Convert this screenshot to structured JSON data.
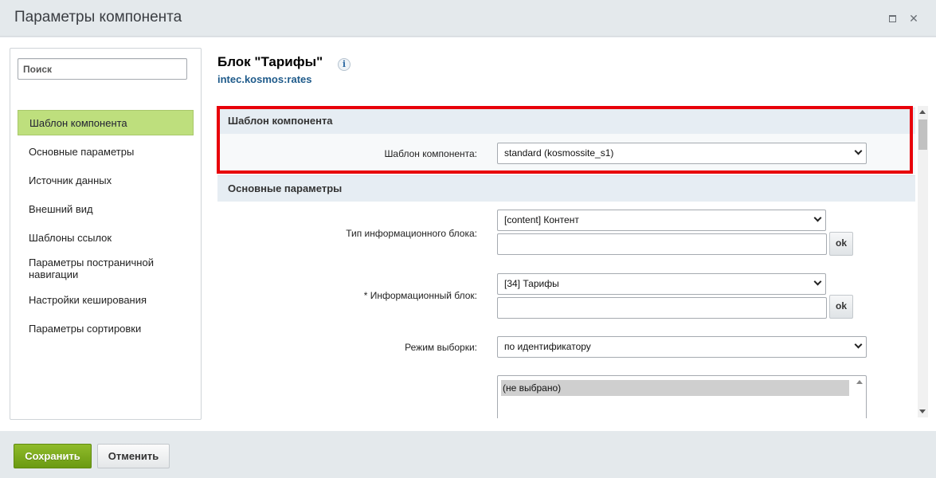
{
  "window": {
    "title": "Параметры компонента",
    "maximize_icon": "maximize-icon",
    "close_icon": "close-icon"
  },
  "sidebar": {
    "search_placeholder": "Поиск",
    "items": [
      {
        "label": "Шаблон компонента",
        "active": true
      },
      {
        "label": "Основные параметры",
        "active": false
      },
      {
        "label": "Источник данных",
        "active": false
      },
      {
        "label": "Внешний вид",
        "active": false
      },
      {
        "label": "Шаблоны ссылок",
        "active": false
      },
      {
        "label": "Параметры постраничной навигации",
        "active": false
      },
      {
        "label": "Настройки кеширования",
        "active": false
      },
      {
        "label": "Параметры сортировки",
        "active": false
      }
    ]
  },
  "header": {
    "block_title": "Блок \"Тарифы\"",
    "info_icon": "i",
    "component_code": "intec.kosmos:rates"
  },
  "sections": {
    "template": {
      "title": "Шаблон компонента",
      "field_label": "Шаблон компонента:",
      "field_value": "standard (kosmossite_s1)"
    },
    "main": {
      "title": "Основные параметры",
      "iblock_type_label": "Тип информационного блока:",
      "iblock_type_value": "[content] Контент",
      "iblock_label": "* Информационный блок:",
      "iblock_value": "[34] Тарифы",
      "ok_label": "ok",
      "mode_label": "Режим выборки:",
      "mode_value": "по идентификатору",
      "list_option": "(не выбрано)"
    }
  },
  "footer": {
    "save_label": "Сохранить",
    "cancel_label": "Отменить"
  },
  "colors": {
    "highlight": "#e8000a",
    "active_nav": "#bedf7d",
    "save_button": "#7aa81c",
    "section_header": "#e6edf3"
  }
}
